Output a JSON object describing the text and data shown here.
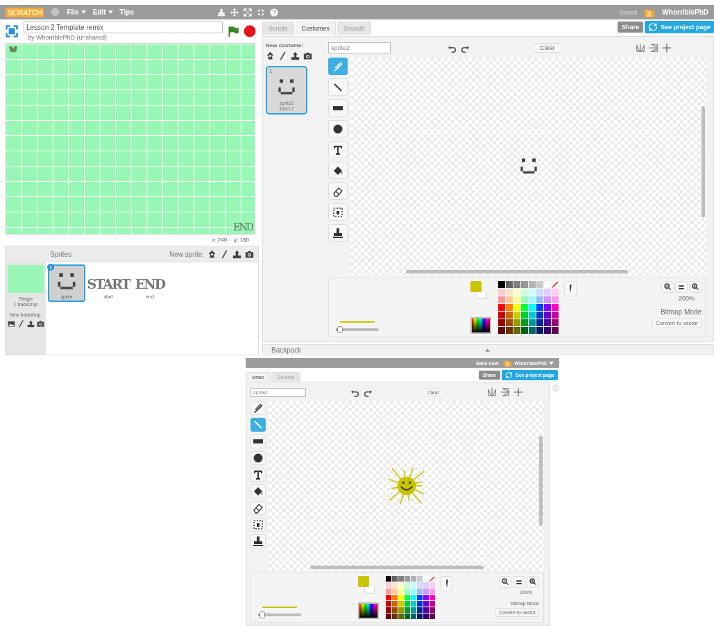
{
  "top_editor": {
    "menu_bar": {
      "logo": "SCRATCH",
      "menus": [
        {
          "label": "File",
          "dropdown": true
        },
        {
          "label": "Edit",
          "dropdown": true
        },
        {
          "label": "Tips",
          "dropdown": false
        }
      ],
      "status": "Saved",
      "user": "WhorriblePhD"
    },
    "stage": {
      "title": "Lesson 2 Template remix",
      "byline": "by WhorriblePhD (unshared)",
      "stage_sprite_text": "END",
      "coords": [
        "x: 240",
        "y: 180"
      ]
    },
    "sprites_pane": {
      "heading": "Sprites",
      "new_sprite_label": "New sprite:",
      "stage_label": "Stage",
      "backdrop_count": "1 backdrop",
      "new_backdrop_label": "New backdrop:",
      "sprites": [
        {
          "kind": "smiley",
          "name": "sprite",
          "selected": true
        },
        {
          "kind": "lettering",
          "art_text": "START",
          "name": "start",
          "selected": false
        },
        {
          "kind": "lettering",
          "art_text": "END",
          "name": "end",
          "selected": false
        }
      ]
    },
    "tabs": [
      {
        "label": "Scripts",
        "selected": false
      },
      {
        "label": "Costumes",
        "selected": true
      },
      {
        "label": "Sounds",
        "selected": false
      }
    ],
    "share_button": "Share",
    "project_page_button": "See project page",
    "costumes_pane": {
      "label": "New costume:",
      "costumes": [
        {
          "number": "1",
          "name": "sprite2",
          "size": "18x17",
          "selected": true
        }
      ]
    },
    "paint_editor": {
      "costume_name": "sprite2",
      "clear_button": "Clear",
      "drawing": {
        "kind": "smiley"
      },
      "tools": [
        {
          "kind": "brush",
          "selected": true
        },
        {
          "kind": "line",
          "selected": false
        },
        {
          "kind": "rectangle",
          "selected": false
        },
        {
          "kind": "ellipse",
          "selected": false
        },
        {
          "kind": "text",
          "selected": false
        },
        {
          "kind": "fill",
          "selected": false
        },
        {
          "kind": "eraser",
          "selected": false
        },
        {
          "kind": "select",
          "selected": false
        },
        {
          "kind": "stamp",
          "selected": false
        }
      ],
      "foreground": {
        "color": "#c9c400"
      },
      "background": {
        "color": "#ffffff"
      },
      "brush_size": {
        "level": 0.1
      },
      "palette": [
        {
          "swatches": [
            {
              "color": "#000000"
            },
            {
              "color": "#666666"
            },
            {
              "color": "#808080"
            },
            {
              "color": "#999999"
            },
            {
              "color": "#b3b3b3"
            },
            {
              "color": "#cccccc"
            },
            {
              "color": "#ffffff"
            }
          ]
        },
        {
          "swatches": [
            {
              "color": "#ffcccc"
            },
            {
              "color": "#ffe5cc"
            },
            {
              "color": "#ffffcc"
            },
            {
              "color": "#ccffdd"
            },
            {
              "color": "#ccffff"
            },
            {
              "color": "#ccddff"
            },
            {
              "color": "#e5ccff"
            },
            {
              "color": "#ffccf2"
            }
          ]
        },
        {
          "swatches": [
            {
              "color": "#ff9999"
            },
            {
              "color": "#ffcc99"
            },
            {
              "color": "#ffff99"
            },
            {
              "color": "#99ffbb"
            },
            {
              "color": "#99ffff"
            },
            {
              "color": "#99bbff"
            },
            {
              "color": "#cc99ff"
            },
            {
              "color": "#ff99e5"
            }
          ]
        },
        {
          "swatches": [
            {
              "color": "#ff0000"
            },
            {
              "color": "#ff8000"
            },
            {
              "color": "#ffff00"
            },
            {
              "color": "#00ff40"
            },
            {
              "color": "#00ffff"
            },
            {
              "color": "#0040ff"
            },
            {
              "color": "#8000ff"
            },
            {
              "color": "#ff00bf"
            }
          ]
        },
        {
          "swatches": [
            {
              "color": "#cc0000"
            },
            {
              "color": "#cc6600"
            },
            {
              "color": "#cccc00"
            },
            {
              "color": "#00cc33"
            },
            {
              "color": "#00cccc"
            },
            {
              "color": "#0033cc"
            },
            {
              "color": "#6600cc"
            },
            {
              "color": "#cc0099"
            }
          ]
        },
        {
          "swatches": [
            {
              "color": "#990000"
            },
            {
              "color": "#994c00"
            },
            {
              "color": "#999900"
            },
            {
              "color": "#009926"
            },
            {
              "color": "#009999"
            },
            {
              "color": "#002699"
            },
            {
              "color": "#4c0099"
            },
            {
              "color": "#990073"
            }
          ]
        },
        {
          "swatches": [
            {
              "color": "#660000"
            },
            {
              "color": "#663300"
            },
            {
              "color": "#666600"
            },
            {
              "color": "#00661a"
            },
            {
              "color": "#006666"
            },
            {
              "color": "#001a66"
            },
            {
              "color": "#330066"
            },
            {
              "color": "#66004c"
            }
          ]
        }
      ],
      "zoom": "200%",
      "mode": "Bitmap Mode",
      "convert_button": "Convert to vector"
    },
    "backpack": "Backpack"
  },
  "bottom_editor": {
    "top_bar": {
      "save": "Save now",
      "user": "WhorriblePhD",
      "dropdown": true
    },
    "tabs": [
      {
        "label": "umes",
        "selected": true
      },
      {
        "label": "Sounds",
        "selected": false
      }
    ],
    "share_button": "Share",
    "project_page_button": "See project page",
    "paint_editor": {
      "costume_name": "sprite2",
      "clear_button": "Clear",
      "drawing": {
        "kind": "sun"
      },
      "tools": [
        {
          "kind": "brush",
          "selected": false
        },
        {
          "kind": "line",
          "selected": true
        },
        {
          "kind": "rectangle",
          "selected": false
        },
        {
          "kind": "ellipse",
          "selected": false
        },
        {
          "kind": "text",
          "selected": false
        },
        {
          "kind": "fill",
          "selected": false
        },
        {
          "kind": "eraser",
          "selected": false
        },
        {
          "kind": "select",
          "selected": false
        },
        {
          "kind": "stamp",
          "selected": false
        }
      ],
      "foreground": {
        "color": "#c9c400"
      },
      "background": {
        "color": "#ffffff"
      },
      "brush_size": {
        "level": 0.1
      },
      "palette": [
        {
          "swatches": [
            {
              "color": "#000000"
            },
            {
              "color": "#666666"
            },
            {
              "color": "#808080"
            },
            {
              "color": "#999999"
            },
            {
              "color": "#b3b3b3"
            },
            {
              "color": "#cccccc"
            },
            {
              "color": "#ffffff"
            }
          ]
        },
        {
          "swatches": [
            {
              "color": "#ffcccc"
            },
            {
              "color": "#ffe5cc"
            },
            {
              "color": "#ffffcc"
            },
            {
              "color": "#ccffdd"
            },
            {
              "color": "#ccffff"
            },
            {
              "color": "#ccddff"
            },
            {
              "color": "#e5ccff"
            },
            {
              "color": "#ffccf2"
            }
          ]
        },
        {
          "swatches": [
            {
              "color": "#ff9999"
            },
            {
              "color": "#ffcc99"
            },
            {
              "color": "#ffff99"
            },
            {
              "color": "#99ffbb"
            },
            {
              "color": "#99ffff"
            },
            {
              "color": "#99bbff"
            },
            {
              "color": "#cc99ff"
            },
            {
              "color": "#ff99e5"
            }
          ]
        },
        {
          "swatches": [
            {
              "color": "#ff0000"
            },
            {
              "color": "#ff8000"
            },
            {
              "color": "#ffff00"
            },
            {
              "color": "#00ff40"
            },
            {
              "color": "#00ffff"
            },
            {
              "color": "#0040ff"
            },
            {
              "color": "#8000ff"
            },
            {
              "color": "#ff00bf"
            }
          ]
        },
        {
          "swatches": [
            {
              "color": "#cc0000"
            },
            {
              "color": "#cc6600"
            },
            {
              "color": "#cccc00"
            },
            {
              "color": "#00cc33"
            },
            {
              "color": "#00cccc"
            },
            {
              "color": "#0033cc"
            },
            {
              "color": "#6600cc"
            },
            {
              "color": "#cc0099"
            }
          ]
        },
        {
          "swatches": [
            {
              "color": "#990000"
            },
            {
              "color": "#994c00"
            },
            {
              "color": "#999900"
            },
            {
              "color": "#009926"
            },
            {
              "color": "#009999"
            },
            {
              "color": "#002699"
            },
            {
              "color": "#4c0099"
            },
            {
              "color": "#990073"
            }
          ]
        },
        {
          "swatches": [
            {
              "color": "#660000"
            },
            {
              "color": "#663300"
            },
            {
              "color": "#666600"
            },
            {
              "color": "#00661a"
            },
            {
              "color": "#006666"
            },
            {
              "color": "#001a66"
            },
            {
              "color": "#330066"
            },
            {
              "color": "#66004c"
            }
          ]
        }
      ],
      "zoom": "200%",
      "mode": "Bitmap Mode",
      "convert_button": "Convert to vector"
    }
  }
}
